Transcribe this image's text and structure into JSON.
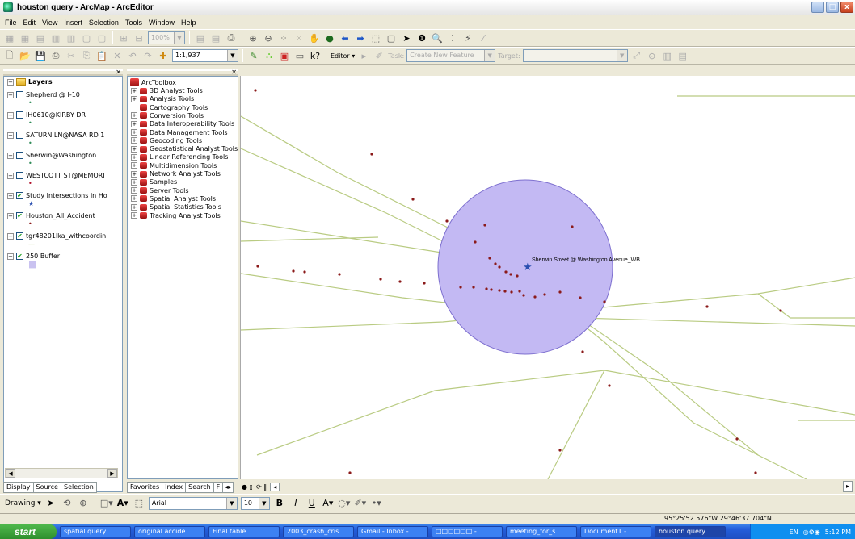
{
  "window": {
    "title": "houston query - ArcMap - ArcEditor"
  },
  "menu": [
    "File",
    "Edit",
    "View",
    "Insert",
    "Selection",
    "Tools",
    "Window",
    "Help"
  ],
  "toolbar": {
    "scale": "1:1,937",
    "editor_label": "Editor",
    "task_label": "Task:",
    "task_value": "Create New Feature",
    "target_label": "Target:",
    "zoom_value": "100%"
  },
  "toc": {
    "root_label": "Layers",
    "layers": [
      {
        "name": "Shepherd @ I-10",
        "checked": false,
        "symbol": "•",
        "symbol_color": "#2e8b57"
      },
      {
        "name": "IH0610@KIRBY DR",
        "checked": false,
        "symbol": "•",
        "symbol_color": "#2e8b57"
      },
      {
        "name": "SATURN LN@NASA RD 1",
        "checked": false,
        "symbol": "•",
        "symbol_color": "#2e8b57"
      },
      {
        "name": "Sherwin@Washington",
        "checked": false,
        "symbol": "•",
        "symbol_color": "#2e8b57"
      },
      {
        "name": "WESTCOTT ST@MEMORI",
        "checked": false,
        "symbol": "•",
        "symbol_color": "#b0102a"
      },
      {
        "name": "Study Intersections in Ho",
        "checked": true,
        "symbol": "★",
        "symbol_color": "#2a4fb0"
      },
      {
        "name": "Houston_All_Accident",
        "checked": true,
        "symbol": "•",
        "symbol_color": "#8b1a1a"
      },
      {
        "name": "tgr48201lka_withcoordin",
        "checked": true,
        "symbol": "—",
        "symbol_color": "#b5c97a"
      },
      {
        "name": "250 Buffer",
        "checked": true,
        "symbol": "■",
        "symbol_color": "#c9c2f0"
      }
    ],
    "tabs": [
      "Display",
      "Source",
      "Selection"
    ]
  },
  "arctoolbox": {
    "title": "ArcToolbox",
    "items": [
      "3D Analyst Tools",
      "Analysis Tools",
      "Cartography Tools",
      "Conversion Tools",
      "Data Interoperability Tools",
      "Data Management Tools",
      "Geocoding Tools",
      "Geostatistical Analyst Tools",
      "Linear Referencing Tools",
      "Multidimension Tools",
      "Network Analyst Tools",
      "Samples",
      "Server Tools",
      "Spatial Analyst Tools",
      "Spatial Statistics Tools",
      "Tracking Analyst Tools"
    ],
    "tabs": [
      "Favorites",
      "Index",
      "Search",
      "F"
    ]
  },
  "map": {
    "label": "Sherwin Street @ Washington Avenue_WB",
    "buffer_fill": "#c3b9f3",
    "road_color": "#b9cb82",
    "point_color": "#8b1a1a"
  },
  "drawing": {
    "label": "Drawing",
    "font": "Arial",
    "size": "10"
  },
  "status": {
    "coords": "95°25'52.576\"W 29°46'37.704\"N"
  },
  "taskbar": {
    "start": "start",
    "tasks": [
      "spatial query",
      "original accide...",
      "Final table",
      "2003_crash_cris",
      "Gmail - Inbox -...",
      "□□□□□□ -...",
      "meeting_for_s...",
      "Document1 -...",
      "houston query..."
    ],
    "lang": "EN",
    "clock": "5:12 PM"
  }
}
